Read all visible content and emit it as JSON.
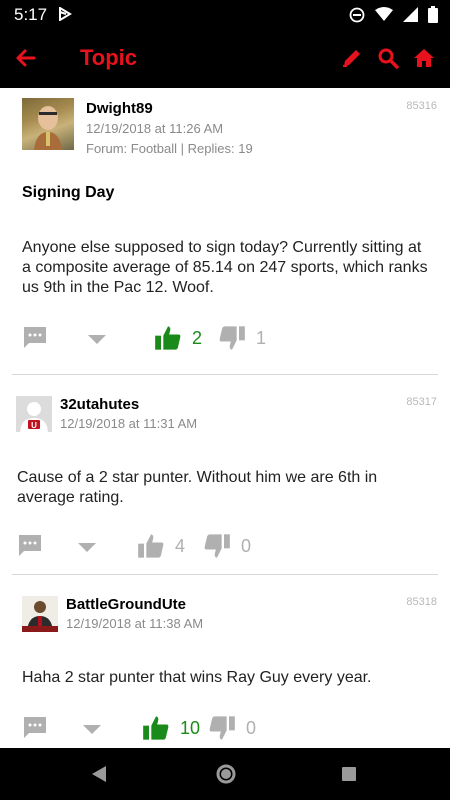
{
  "status_bar": {
    "time": "5:17"
  },
  "app_bar": {
    "title": "Topic"
  },
  "colors": {
    "accent": "#e8121e",
    "like_active": "#1a8a1a",
    "icon_grey": "#b0b0b0",
    "meta_grey": "#8a8a8a"
  },
  "posts": [
    {
      "username": "Dwight89",
      "date": "12/19/2018 at 11:26 AM",
      "forum": "Forum: Football | Replies: 19",
      "post_id": "85316",
      "title": "Signing Day",
      "body": "Anyone else supposed to sign today? Currently sitting at a composite average of 85.14 on 247 sports, which ranks us 9th in the Pac 12. Woof.",
      "likes": "2",
      "dislikes": "1",
      "liked": true
    },
    {
      "username": "32utahutes",
      "date": "12/19/2018 at 11:31 AM",
      "post_id": "85317",
      "body": "Cause of a 2 star punter. Without him we are 6th in average rating.",
      "likes": "4",
      "dislikes": "0",
      "liked": false
    },
    {
      "username": "BattleGroundUte",
      "date": "12/19/2018 at 11:38 AM",
      "post_id": "85318",
      "body": "Haha 2 star punter that wins Ray Guy every year.",
      "likes": "10",
      "dislikes": "0",
      "liked": true
    }
  ]
}
